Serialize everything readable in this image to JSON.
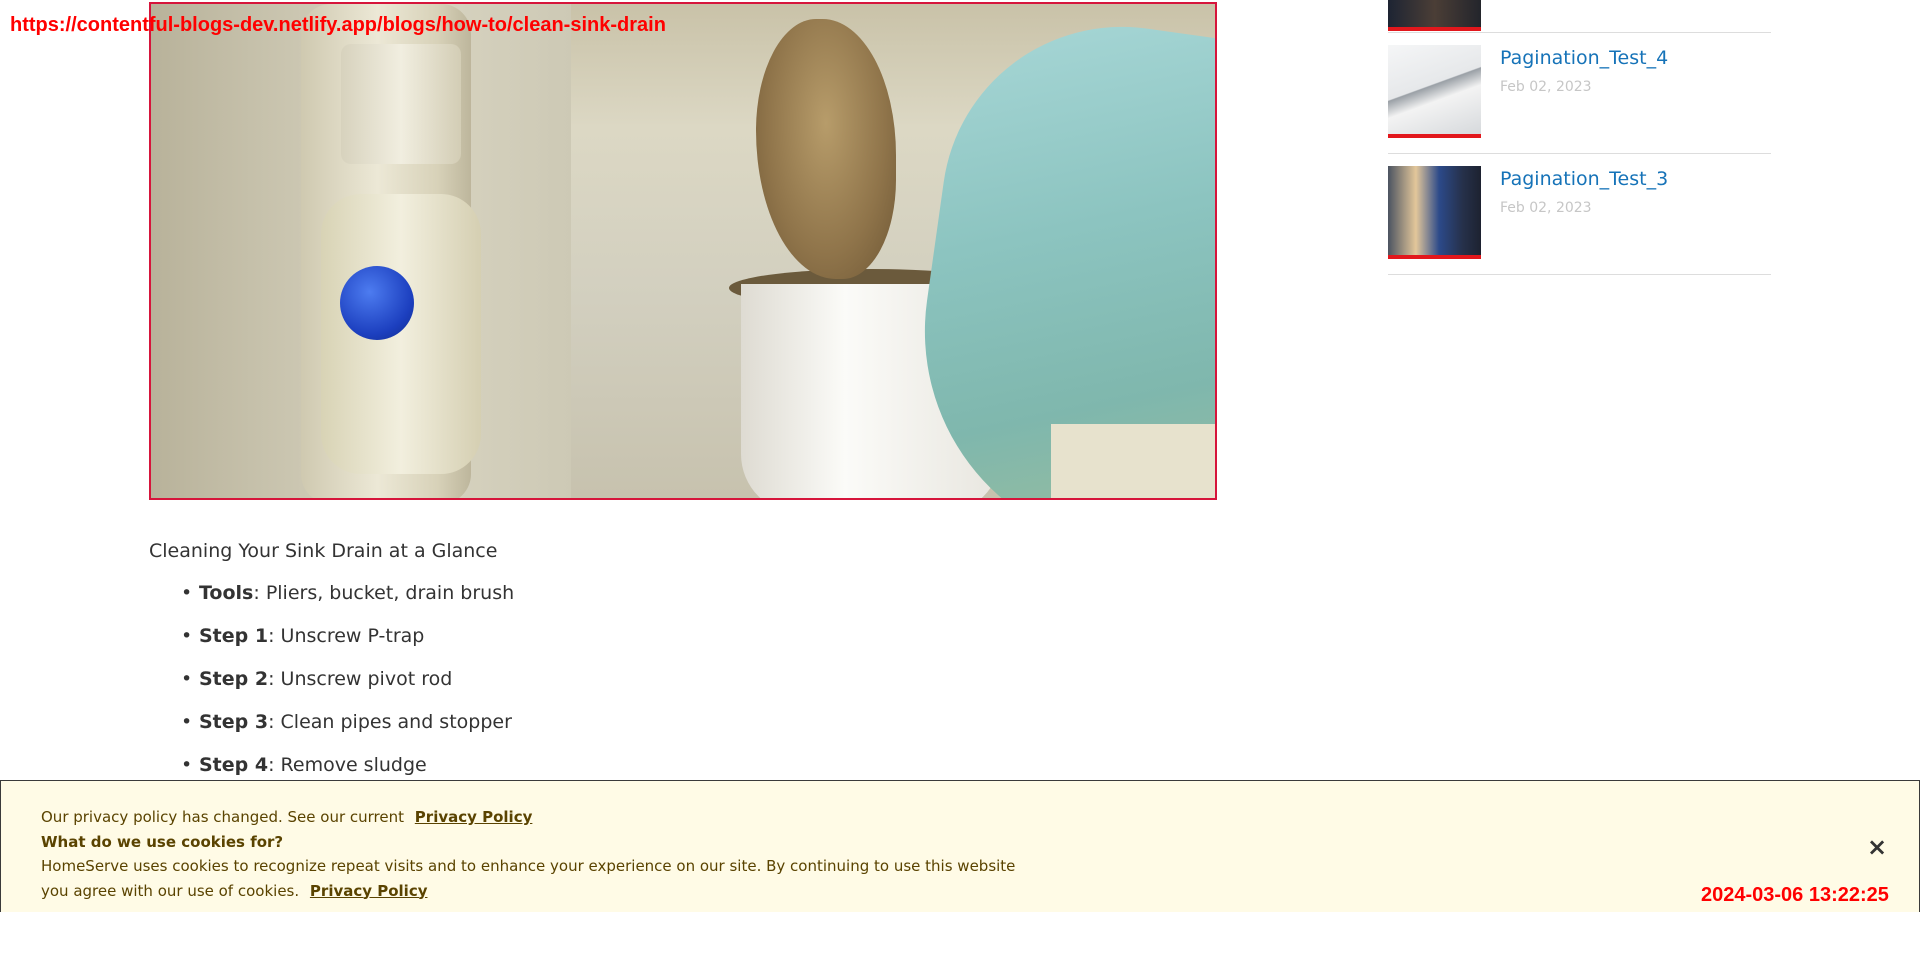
{
  "overlay": {
    "url": "https://contentful-blogs-dev.netlify.app/blogs/how-to/clean-sink-drain",
    "timestamp": "2024-03-06 13:22:25"
  },
  "article": {
    "hero_image": "sink drain cleaning photo (gloved hand holding sludge over pipe)",
    "glance_heading": "Cleaning Your Sink Drain at a Glance",
    "steps": [
      {
        "label": "Tools",
        "text": ": Pliers, bucket, drain brush"
      },
      {
        "label": "Step 1",
        "text": ": Unscrew P-trap"
      },
      {
        "label": "Step 2",
        "text": ": Unscrew pivot rod"
      },
      {
        "label": "Step 3",
        "text": ": Clean pipes and stopper"
      },
      {
        "label": "Step 4",
        "text": ": Remove sludge"
      }
    ]
  },
  "sidebar": {
    "posts": [
      {
        "title": "Pagination_Test_4",
        "date": "Feb 02, 2023"
      },
      {
        "title": "Pagination_Test_3",
        "date": "Feb 02, 2023"
      }
    ]
  },
  "cookie_banner": {
    "line1": "Our privacy policy has changed. See our current",
    "privacy_link_1": "Privacy Policy",
    "question": "What do we use cookies for?",
    "body": "HomeServe uses cookies to recognize repeat visits and to enhance your experience on our site. By continuing to use this website you agree with our use of cookies.",
    "privacy_link_2": "Privacy Policy",
    "close_icon": "×"
  }
}
